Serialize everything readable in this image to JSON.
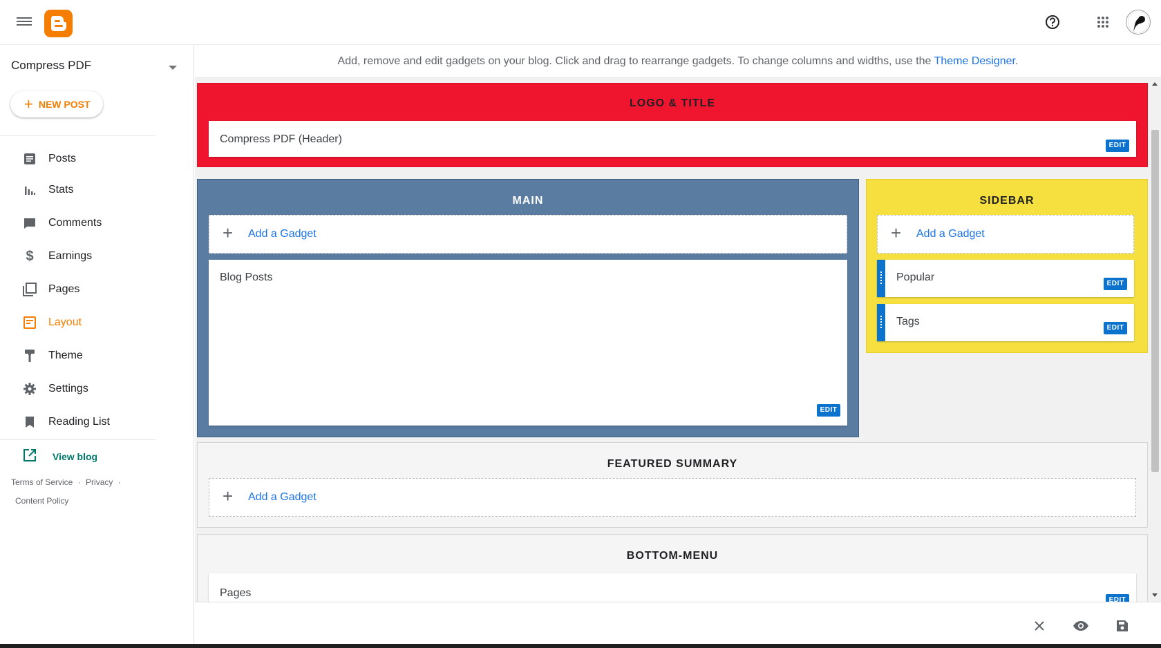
{
  "app": {
    "name": "Blogger"
  },
  "sidebar": {
    "blog_name": "Compress PDF",
    "new_post_label": "NEW POST",
    "items": [
      {
        "label": "Posts",
        "icon": "posts-icon"
      },
      {
        "label": "Stats",
        "icon": "stats-icon"
      },
      {
        "label": "Comments",
        "icon": "comments-icon"
      },
      {
        "label": "Earnings",
        "icon": "dollar-icon"
      },
      {
        "label": "Pages",
        "icon": "pages-icon"
      },
      {
        "label": "Layout",
        "icon": "layout-icon",
        "active": true
      },
      {
        "label": "Theme",
        "icon": "paint-roller-icon"
      },
      {
        "label": "Settings",
        "icon": "gear-icon"
      },
      {
        "label": "Reading List",
        "icon": "bookmark-icon"
      }
    ],
    "view_blog_label": "View blog",
    "footer": {
      "terms": "Terms of Service",
      "privacy": "Privacy",
      "content_policy": "Content Policy",
      "separator": "·"
    }
  },
  "hint": {
    "text": "Add, remove and edit gadgets on your blog. Click and drag to rearrange gadgets. To change columns and widths, use the ",
    "link": "Theme Designer",
    "suffix": "."
  },
  "layout": {
    "edit_label": "EDIT",
    "add_gadget_label": "Add a Gadget",
    "sections": {
      "logo_title": {
        "title": "LOGO & TITLE",
        "color": "#f0152f",
        "gadgets": [
          "Compress PDF (Header)"
        ]
      },
      "main": {
        "title": "MAIN",
        "color": "#5b7ca1",
        "gadgets": [
          "Blog Posts"
        ]
      },
      "sidebar": {
        "title": "SIDEBAR",
        "color": "#f6e040",
        "gadgets": [
          "Popular",
          "Tags"
        ]
      },
      "featured_summary": {
        "title": "FEATURED SUMMARY",
        "color": "#f5f5f5"
      },
      "bottom_menu": {
        "title": "BOTTOM-MENU",
        "color": "#f5f5f5",
        "gadgets": [
          "Pages"
        ]
      }
    }
  },
  "colors": {
    "accent": "#f57d00",
    "link": "#1a73e8",
    "edit": "#0b73ce",
    "view_blog": "#00796b"
  }
}
